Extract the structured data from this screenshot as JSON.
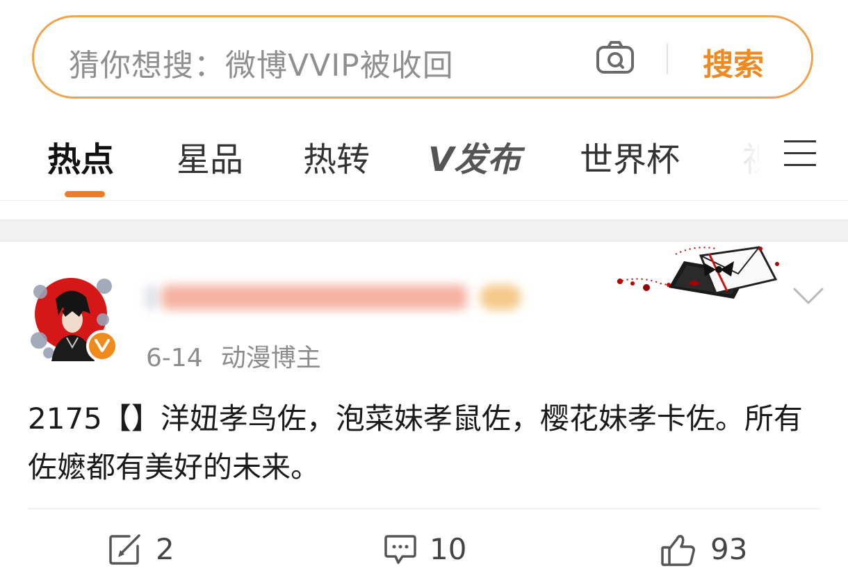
{
  "search": {
    "placeholder": "猜你想搜：微博VVIP被收回",
    "button_label": "搜索",
    "camera_icon": "camera-icon"
  },
  "tabs": [
    {
      "label": "热点",
      "active": true
    },
    {
      "label": "星品",
      "active": false
    },
    {
      "label": "热转",
      "active": false
    },
    {
      "label": "V发布",
      "active": false
    },
    {
      "label": "世界杯",
      "active": false
    },
    {
      "label": "视",
      "active": false
    }
  ],
  "colors": {
    "accent": "#f47b20",
    "search_border": "#f0a24d",
    "search_button": "#ee8a1f",
    "verified": "#f08a1a"
  },
  "post": {
    "date": "6-14",
    "author_tag": "动漫博主",
    "content": "2175【】洋妞孝鸟佐，泡菜妹孝鼠佐，樱花妹孝卡佐。所有佐嬷都有美好的未来。",
    "actions": {
      "repost_count": "2",
      "comment_count": "10",
      "like_count": "93"
    }
  }
}
